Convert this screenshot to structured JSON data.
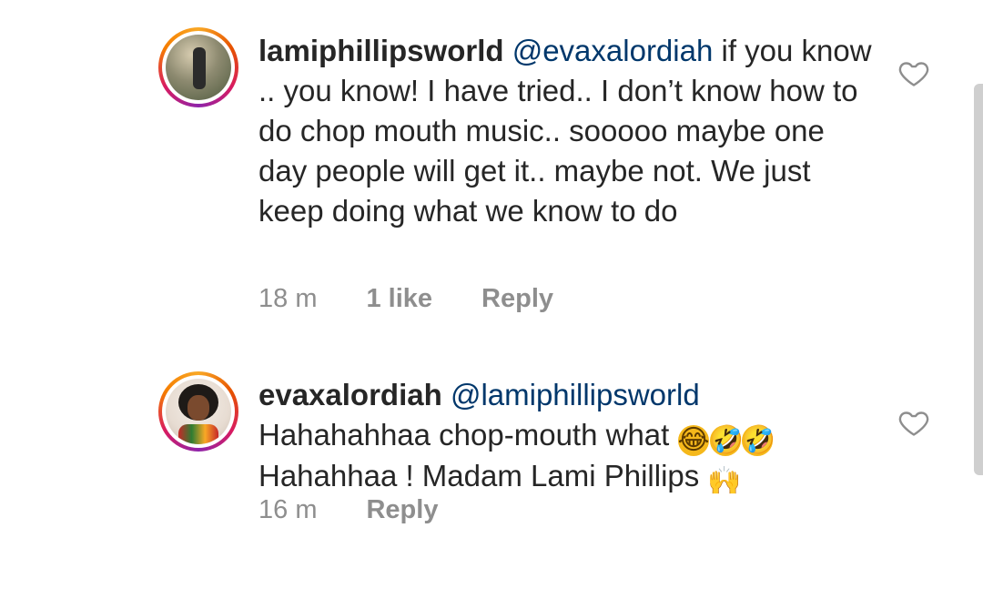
{
  "comments": [
    {
      "username": "lamiphillipsworld",
      "mention": "@evaxalordiah",
      "text": " if you know .. you know! I have tried.. I don’t know how to do chop mouth music.. sooooo maybe one day people will get it.. maybe not. We just keep doing what we know to do",
      "time": "18 m",
      "likes": "1 like",
      "reply": "Reply",
      "icons": {
        "like": "heart-outline-icon"
      }
    },
    {
      "username": "evaxalordiah",
      "mention": "@lamiphillipsworld",
      "text_line1": "Hahahahhaa chop-mouth what ",
      "text_line2": "Hahahhaa ! Madam Lami Phillips ",
      "emojis_line1": [
        "😂",
        "🤣",
        "🤣"
      ],
      "emoji_line2": "🙌",
      "time": "16 m",
      "reply": "Reply",
      "icons": {
        "like": "heart-outline-icon"
      }
    }
  ],
  "colors": {
    "text": "#262626",
    "mention": "#00376b",
    "meta": "#8e8e8e",
    "heart_outline": "#8e8e8e"
  }
}
